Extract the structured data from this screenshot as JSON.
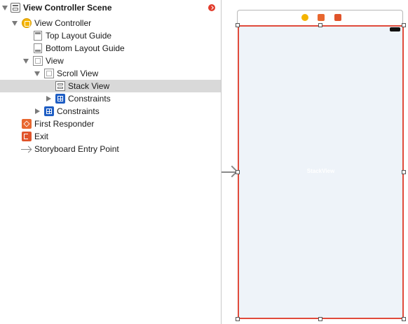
{
  "outline": {
    "scene_title": "View Controller Scene",
    "items": [
      {
        "label": "View Controller"
      },
      {
        "label": "Top Layout Guide"
      },
      {
        "label": "Bottom Layout Guide"
      },
      {
        "label": "View"
      },
      {
        "label": "Scroll View"
      },
      {
        "label": "Stack View"
      },
      {
        "label": "Constraints"
      },
      {
        "label": "Constraints"
      },
      {
        "label": "First Responder"
      },
      {
        "label": "Exit"
      },
      {
        "label": "Storyboard Entry Point"
      }
    ],
    "selected_item": "Stack View"
  },
  "canvas": {
    "stack_caption": "StackView"
  },
  "colors": {
    "selection_bg": "#d9d9d9",
    "selected_view_border": "#e04a3b",
    "canvas_fill": "#eef3f9",
    "view_controller_icon": "#f4b400",
    "constraints_icon": "#1f5ec4",
    "first_responder_icon": "#e8672f",
    "exit_icon": "#e0542b",
    "warning_badge": "#e23c2c"
  }
}
